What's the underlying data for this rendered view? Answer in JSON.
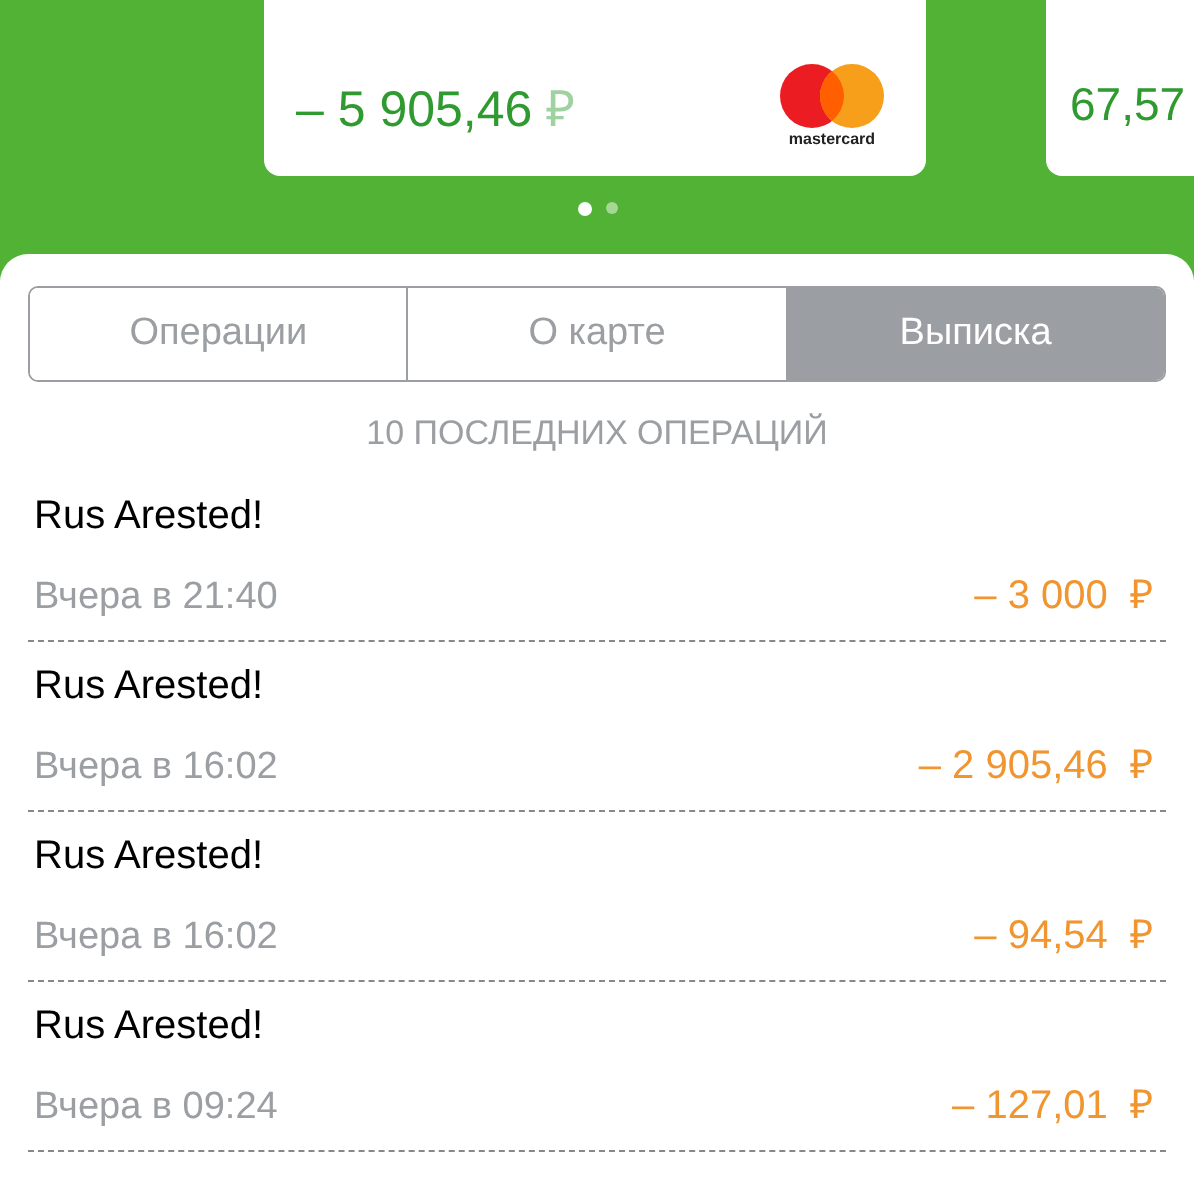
{
  "cards": [
    {
      "amount": "– 5 905,46",
      "currency": "₽",
      "brand": "mastercard",
      "kind": "full"
    },
    {
      "amount": "67,57",
      "kind": "partial"
    }
  ],
  "pager": [
    {
      "selected": true
    },
    {
      "selected": false
    }
  ],
  "tabs": [
    {
      "label": "Операции",
      "selected": false
    },
    {
      "label": "О карте",
      "selected": false
    },
    {
      "label": "Выписка",
      "selected": true
    }
  ],
  "section_title": "10 ПОСЛЕДНИХ ОПЕРАЦИЙ",
  "operations": [
    {
      "title": "Rus Arested!",
      "time": "Вчера в 21:40",
      "amount": "– 3 000",
      "currency": "₽"
    },
    {
      "title": "Rus Arested!",
      "time": "Вчера в 16:02",
      "amount": "– 2 905,46",
      "currency": "₽"
    },
    {
      "title": "Rus Arested!",
      "time": "Вчера в 16:02",
      "amount": "– 94,54",
      "currency": "₽"
    },
    {
      "title": "Rus Arested!",
      "time": "Вчера в 09:24",
      "amount": "– 127,01",
      "currency": "₽"
    }
  ]
}
